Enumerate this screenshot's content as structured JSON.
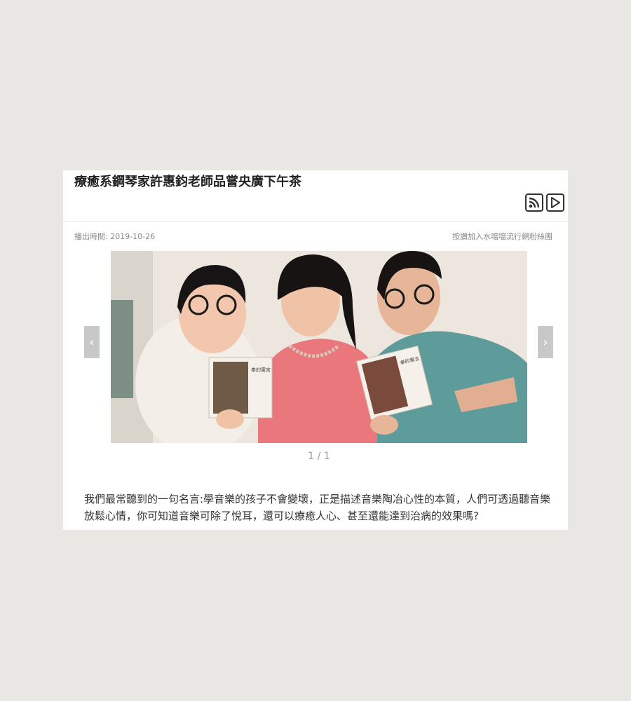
{
  "article": {
    "title": "療癒系鋼琴家許惠鈞老師品嘗央廣下午茶",
    "air_date": "播出時間: 2019-10-26",
    "fan_link": "按讚加入水噹噹流行網粉絲團",
    "description": "我們最常聽到的一句名言:學音樂的孩子不會變壞，正是描述音樂陶冶心性的本質，人們可透過聽音樂放鬆心情，你可知道音樂可除了悅耳，還可以療癒人心、甚至還能達到治病的效果嗎?"
  },
  "toolbar": {
    "rss_icon": "rss-icon",
    "play_icon": "play-icon"
  },
  "gallery": {
    "counter": "1 / 1",
    "prev_label": "‹",
    "next_label": "›",
    "album_text": "拳的寓言"
  }
}
